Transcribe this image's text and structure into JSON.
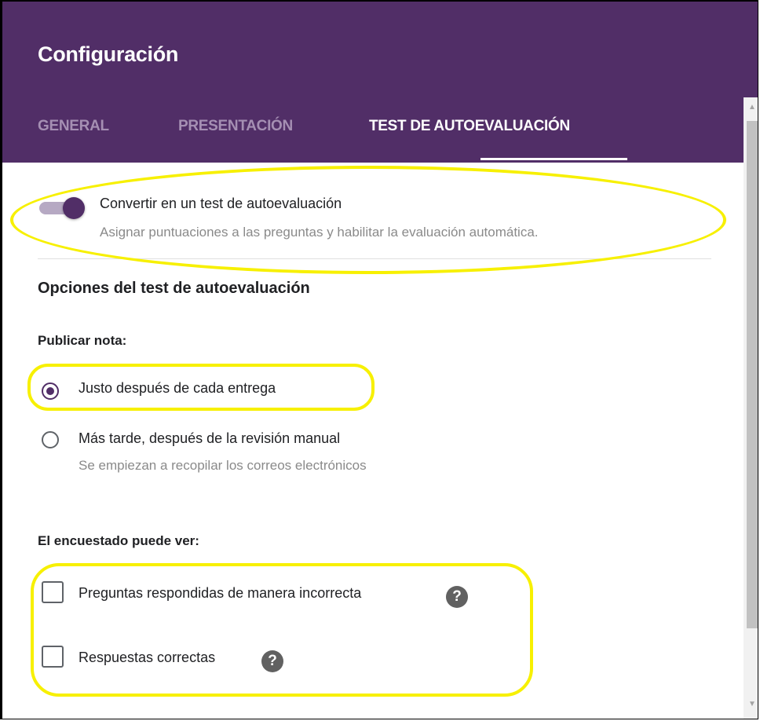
{
  "header": {
    "title": "Configuración",
    "tabs": [
      {
        "label": "GENERAL",
        "active": false
      },
      {
        "label": "PRESENTACIÓN",
        "active": false
      },
      {
        "label": "TEST DE AUTOEVALUACIÓN",
        "active": true
      }
    ],
    "background_color": "#512e67"
  },
  "quiz_toggle": {
    "label": "Convertir en un test de autoevaluación",
    "description": "Asignar puntuaciones a las preguntas y habilitar la evaluación automática.",
    "enabled": true
  },
  "quiz_options": {
    "section_title": "Opciones del test de autoevaluación",
    "release_grade": {
      "label": "Publicar nota:",
      "options": [
        {
          "label": "Justo después de cada entrega",
          "selected": true
        },
        {
          "label": "Más tarde, después de la revisión manual",
          "description": "Se empiezan a recopilar los correos electrónicos",
          "selected": false
        }
      ]
    },
    "respondent_can_see": {
      "label": "El encuestado puede ver:",
      "options": [
        {
          "label": "Preguntas respondidas de manera incorrecta",
          "checked": false,
          "help_icon": "?"
        },
        {
          "label": "Respuestas correctas",
          "checked": false,
          "help_icon": "?"
        }
      ]
    }
  },
  "scrollbar": {
    "up_glyph": "▲",
    "down_glyph": "▼"
  },
  "highlight_color": "#f7f000"
}
